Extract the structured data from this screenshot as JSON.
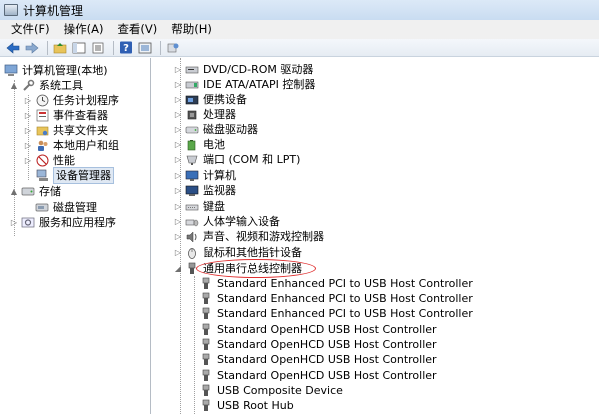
{
  "window": {
    "title": "计算机管理"
  },
  "menu": [
    {
      "label": "文件(F)"
    },
    {
      "label": "操作(A)"
    },
    {
      "label": "查看(V)"
    },
    {
      "label": "帮助(H)"
    }
  ],
  "toolbar": {
    "icons": [
      "back-arrow-icon",
      "forward-arrow-icon",
      "up-folder-icon",
      "show-hide-tree-icon",
      "properties-icon",
      "help-icon",
      "console-view-icon",
      "refresh-devices-icon"
    ]
  },
  "left_tree": [
    {
      "label": "计算机管理(本地)",
      "icon": "computer-management-icon",
      "level": 0,
      "arrow": ""
    },
    {
      "label": "系统工具",
      "icon": "system-tools-icon",
      "level": 1,
      "arrow": "▲"
    },
    {
      "label": "任务计划程序",
      "icon": "clock-icon",
      "level": 2,
      "arrow": "▷"
    },
    {
      "label": "事件查看器",
      "icon": "event-viewer-icon",
      "level": 2,
      "arrow": "▷"
    },
    {
      "label": "共享文件夹",
      "icon": "shared-folder-icon",
      "level": 2,
      "arrow": "▷"
    },
    {
      "label": "本地用户和组",
      "icon": "users-icon",
      "level": 2,
      "arrow": "▷"
    },
    {
      "label": "性能",
      "icon": "performance-icon",
      "level": 2,
      "arrow": "▷"
    },
    {
      "label": "设备管理器",
      "icon": "device-manager-icon",
      "level": 2,
      "arrow": "",
      "selected": true
    },
    {
      "label": "存储",
      "icon": "storage-icon",
      "level": 1,
      "arrow": "▲"
    },
    {
      "label": "磁盘管理",
      "icon": "disk-management-icon",
      "level": 2,
      "arrow": ""
    },
    {
      "label": "服务和应用程序",
      "icon": "services-icon",
      "level": 1,
      "arrow": "▷"
    }
  ],
  "device_tree": [
    {
      "label": "DVD/CD-ROM 驱动器",
      "icon": "dvd-drive-icon",
      "arrow": "▷"
    },
    {
      "label": "IDE ATA/ATAPI 控制器",
      "icon": "ide-controller-icon",
      "arrow": "▷"
    },
    {
      "label": "便携设备",
      "icon": "portable-device-icon",
      "arrow": "▷"
    },
    {
      "label": "处理器",
      "icon": "processor-icon",
      "arrow": "▷"
    },
    {
      "label": "磁盘驱动器",
      "icon": "disk-drive-icon",
      "arrow": "▷"
    },
    {
      "label": "电池",
      "icon": "battery-icon",
      "arrow": "▷"
    },
    {
      "label": "端口 (COM 和 LPT)",
      "icon": "port-icon",
      "arrow": "▷"
    },
    {
      "label": "计算机",
      "icon": "computer-icon",
      "arrow": "▷"
    },
    {
      "label": "监视器",
      "icon": "monitor-icon",
      "arrow": "▷"
    },
    {
      "label": "键盘",
      "icon": "keyboard-icon",
      "arrow": "▷"
    },
    {
      "label": "人体学输入设备",
      "icon": "hid-icon",
      "arrow": "▷"
    },
    {
      "label": "声音、视频和游戏控制器",
      "icon": "sound-icon",
      "arrow": "▷"
    },
    {
      "label": "鼠标和其他指针设备",
      "icon": "mouse-icon",
      "arrow": "▷"
    },
    {
      "label": "通用串行总线控制器",
      "icon": "usb-icon",
      "arrow": "◢",
      "highlighted": true
    }
  ],
  "usb_children": [
    {
      "label": "Standard Enhanced PCI to USB Host Controller",
      "icon": "usb-device-icon"
    },
    {
      "label": "Standard Enhanced PCI to USB Host Controller",
      "icon": "usb-device-icon"
    },
    {
      "label": "Standard Enhanced PCI to USB Host Controller",
      "icon": "usb-device-icon"
    },
    {
      "label": "Standard OpenHCD USB Host Controller",
      "icon": "usb-device-icon"
    },
    {
      "label": "Standard OpenHCD USB Host Controller",
      "icon": "usb-device-icon"
    },
    {
      "label": "Standard OpenHCD USB Host Controller",
      "icon": "usb-device-icon"
    },
    {
      "label": "Standard OpenHCD USB Host Controller",
      "icon": "usb-device-icon"
    },
    {
      "label": "USB Composite Device",
      "icon": "usb-device-icon"
    },
    {
      "label": "USB Root Hub",
      "icon": "usb-device-icon"
    }
  ],
  "colors": {
    "highlight_oval": "#e03030",
    "selection_bg": "#dfe8f3",
    "titlebar": "#c9dcf1"
  }
}
